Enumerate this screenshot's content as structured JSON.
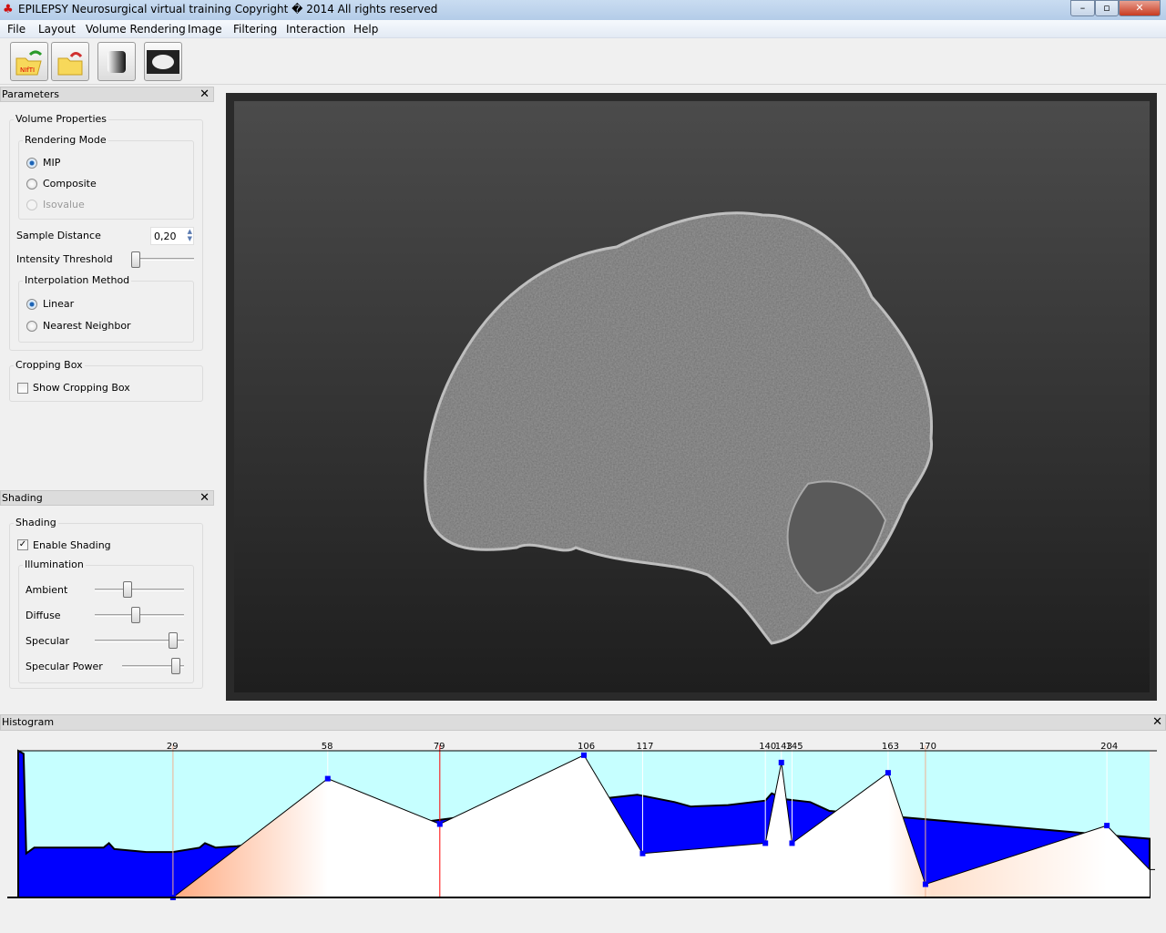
{
  "window": {
    "title": "EPILEPSY Neurosurgical virtual training Copyright � 2014 All rights reserved",
    "minimize": "–",
    "maximize": "▫",
    "close": "✕"
  },
  "menu": [
    "File",
    "Layout",
    "Volume Rendering",
    "Image",
    "Filtering",
    "Interaction",
    "Help"
  ],
  "toolbar": [
    {
      "icon": "open-nifti-icon",
      "badge": "NIfTI"
    },
    {
      "icon": "open-folder-icon"
    },
    {
      "icon": "gradient-icon"
    },
    {
      "icon": "brain-icon"
    }
  ],
  "parameters": {
    "title": "Parameters",
    "close": "✕",
    "volume_properties": "Volume Properties",
    "rendering_mode": {
      "label": "Rendering Mode",
      "options": [
        "MIP",
        "Composite",
        "Isovalue"
      ],
      "selected": "MIP",
      "disabled": [
        "Isovalue"
      ]
    },
    "sample_distance": {
      "label": "Sample Distance",
      "value": "0,20"
    },
    "intensity_threshold": {
      "label": "Intensity Threshold",
      "value": 0
    },
    "interpolation": {
      "label": "Interpolation Method",
      "options": [
        "Linear",
        "Nearest Neighbor"
      ],
      "selected": "Linear"
    },
    "cropping": {
      "label": "Cropping Box",
      "checkbox": "Show Cropping Box",
      "checked": false
    }
  },
  "shading": {
    "title": "Shading",
    "close": "✕",
    "group": "Shading",
    "enable": "Enable Shading",
    "enabled": true,
    "illumination": "Illumination",
    "sliders": [
      {
        "label": "Ambient",
        "value": 0.37
      },
      {
        "label": "Diffuse",
        "value": 0.46
      },
      {
        "label": "Specular",
        "value": 0.88
      },
      {
        "label": "Specular Power",
        "value": 0.88
      }
    ]
  },
  "histogram": {
    "title": "Histogram",
    "close": "✕"
  },
  "chart_data": {
    "type": "area",
    "xlim": [
      0,
      212
    ],
    "ylim": [
      0,
      1
    ],
    "control_points": [
      [
        29,
        0
      ],
      [
        58,
        0.81
      ],
      [
        79,
        0.5
      ],
      [
        106,
        0.97
      ],
      [
        117,
        0.3
      ],
      [
        140,
        0.37
      ],
      [
        143,
        0.92
      ],
      [
        145,
        0.37
      ],
      [
        163,
        0.85
      ],
      [
        170,
        0.09
      ],
      [
        204,
        0.49
      ],
      [
        213,
        0.19
      ]
    ],
    "tick_labels": [
      "29",
      "58",
      "79",
      "106",
      "117",
      "140",
      "143",
      "145",
      "163",
      "170",
      "204"
    ],
    "selected_point": 79,
    "histogram": [
      [
        0,
        1
      ],
      [
        1,
        0.98
      ],
      [
        1.5,
        0.3
      ],
      [
        3,
        0.34
      ],
      [
        16,
        0.34
      ],
      [
        17,
        0.37
      ],
      [
        18,
        0.33
      ],
      [
        24,
        0.31
      ],
      [
        29,
        0.31
      ],
      [
        34,
        0.34
      ],
      [
        35,
        0.37
      ],
      [
        37,
        0.34
      ],
      [
        41,
        0.35
      ],
      [
        111,
        0.68
      ],
      [
        116,
        0.7
      ],
      [
        123,
        0.65
      ],
      [
        126,
        0.62
      ],
      [
        133,
        0.63
      ],
      [
        140,
        0.66
      ],
      [
        141.2,
        0.71
      ],
      [
        143.6,
        0.67
      ],
      [
        148.4,
        0.65
      ],
      [
        152,
        0.59
      ],
      [
        212,
        0.4
      ]
    ],
    "colors": {
      "background": "#c6ffff",
      "histogram": "#0000ff",
      "opacity_area": "#ffffff",
      "color_low": "#ffaa80",
      "selected_line": "#ff0000"
    }
  }
}
